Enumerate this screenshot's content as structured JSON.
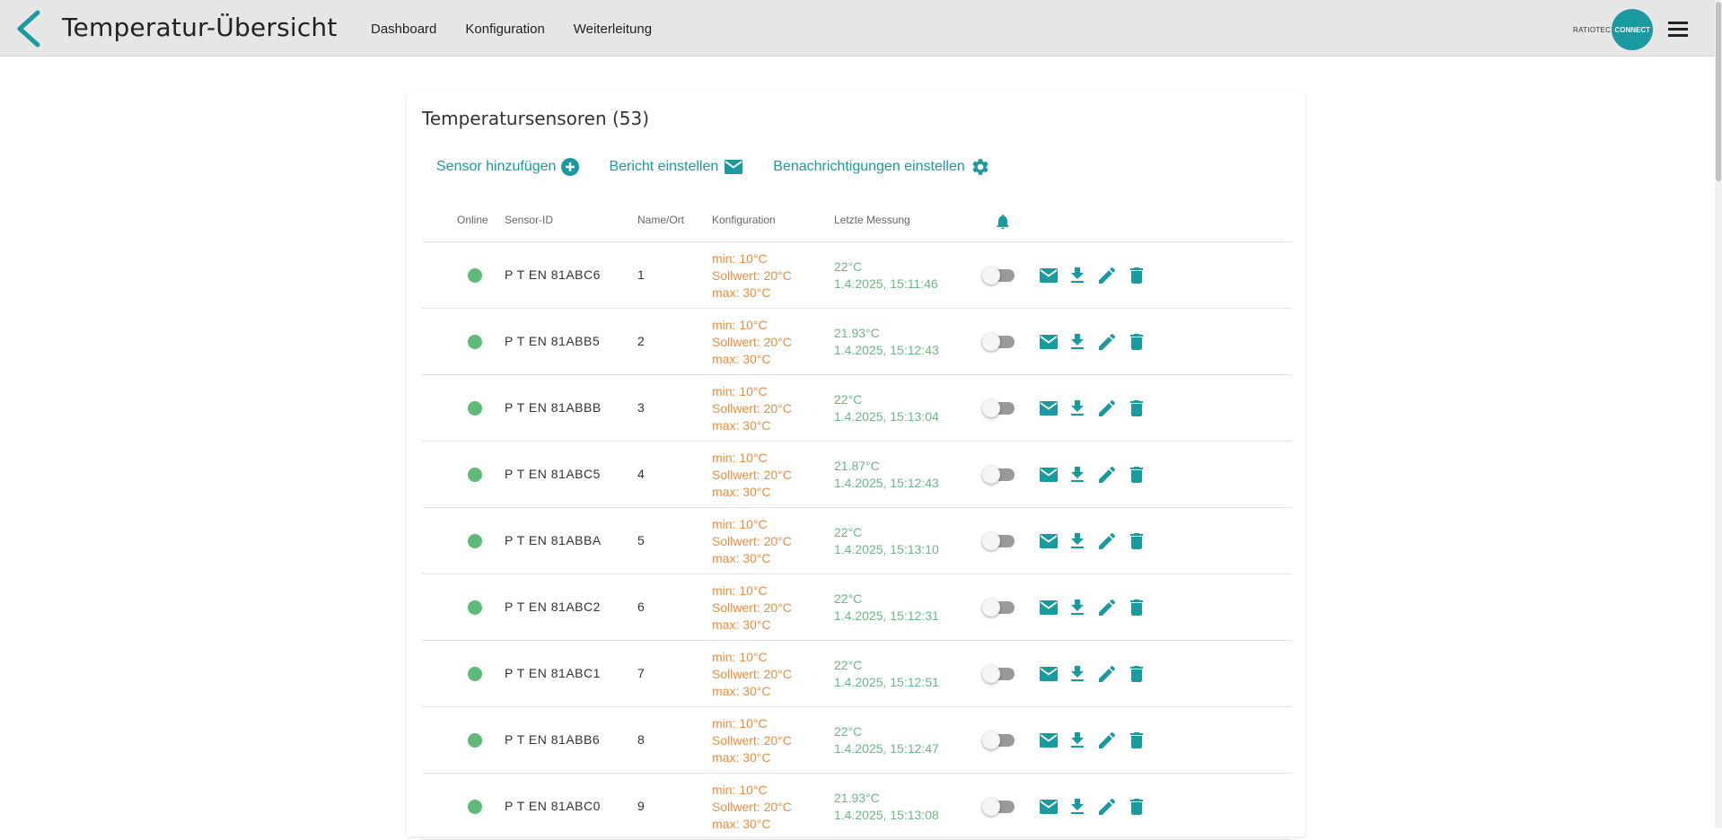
{
  "header": {
    "title": "Temperatur-Übersicht",
    "nav": [
      "Dashboard",
      "Konfiguration",
      "Weiterleitung"
    ],
    "brand_text": "RATIOTEC",
    "brand_badge": "CONNECT"
  },
  "card": {
    "title": "Temperatursensoren (53)",
    "actions": {
      "add_sensor": "Sensor hinzufügen",
      "report": "Bericht einstellen",
      "notifications": "Benachrichtigungen einstellen"
    },
    "columns": {
      "online": "Online",
      "sensor_id": "Sensor-ID",
      "name": "Name/Ort",
      "config": "Konfiguration",
      "last": "Letzte Messung"
    }
  },
  "rows": [
    {
      "online": true,
      "id": "P T EN 81ABC6",
      "name": "1",
      "min": "min: 10°C",
      "set": "Sollwert: 20°C",
      "max": "max: 30°C",
      "temp": "22°C",
      "time": "1.4.2025, 15:11:46",
      "notify": false
    },
    {
      "online": true,
      "id": "P T EN 81ABB5",
      "name": "2",
      "min": "min: 10°C",
      "set": "Sollwert: 20°C",
      "max": "max: 30°C",
      "temp": "21.93°C",
      "time": "1.4.2025, 15:12:43",
      "notify": false
    },
    {
      "online": true,
      "id": "P T EN 81ABBB",
      "name": "3",
      "min": "min: 10°C",
      "set": "Sollwert: 20°C",
      "max": "max: 30°C",
      "temp": "22°C",
      "time": "1.4.2025, 15:13:04",
      "notify": false
    },
    {
      "online": true,
      "id": "P T EN 81ABC5",
      "name": "4",
      "min": "min: 10°C",
      "set": "Sollwert: 20°C",
      "max": "max: 30°C",
      "temp": "21.87°C",
      "time": "1.4.2025, 15:12:43",
      "notify": false
    },
    {
      "online": true,
      "id": "P T EN 81ABBA",
      "name": "5",
      "min": "min: 10°C",
      "set": "Sollwert: 20°C",
      "max": "max: 30°C",
      "temp": "22°C",
      "time": "1.4.2025, 15:13:10",
      "notify": false
    },
    {
      "online": true,
      "id": "P T EN 81ABC2",
      "name": "6",
      "min": "min: 10°C",
      "set": "Sollwert: 20°C",
      "max": "max: 30°C",
      "temp": "22°C",
      "time": "1.4.2025, 15:12:31",
      "notify": false
    },
    {
      "online": true,
      "id": "P T EN 81ABC1",
      "name": "7",
      "min": "min: 10°C",
      "set": "Sollwert: 20°C",
      "max": "max: 30°C",
      "temp": "22°C",
      "time": "1.4.2025, 15:12:51",
      "notify": false
    },
    {
      "online": true,
      "id": "P T EN 81ABB6",
      "name": "8",
      "min": "min: 10°C",
      "set": "Sollwert: 20°C",
      "max": "max: 30°C",
      "temp": "22°C",
      "time": "1.4.2025, 15:12:47",
      "notify": false
    },
    {
      "online": true,
      "id": "P T EN 81ABC0",
      "name": "9",
      "min": "min: 10°C",
      "set": "Sollwert: 20°C",
      "max": "max: 30°C",
      "temp": "21.93°C",
      "time": "1.4.2025, 15:13:08",
      "notify": false
    }
  ],
  "icons": {
    "back": "chevron-left-icon",
    "menu": "hamburger-menu-icon",
    "add": "plus-circle-icon",
    "report": "envelope-icon",
    "settings": "gear-icon",
    "bell": "bell-icon",
    "row_actions": [
      "envelope-icon",
      "download-icon",
      "pencil-icon",
      "trash-icon"
    ]
  },
  "colors": {
    "accent": "#1a9a9e",
    "online": "#5fba79",
    "config": "#ee8c3c",
    "measure": "#6bb788",
    "header_bg": "#e6e6e6"
  }
}
